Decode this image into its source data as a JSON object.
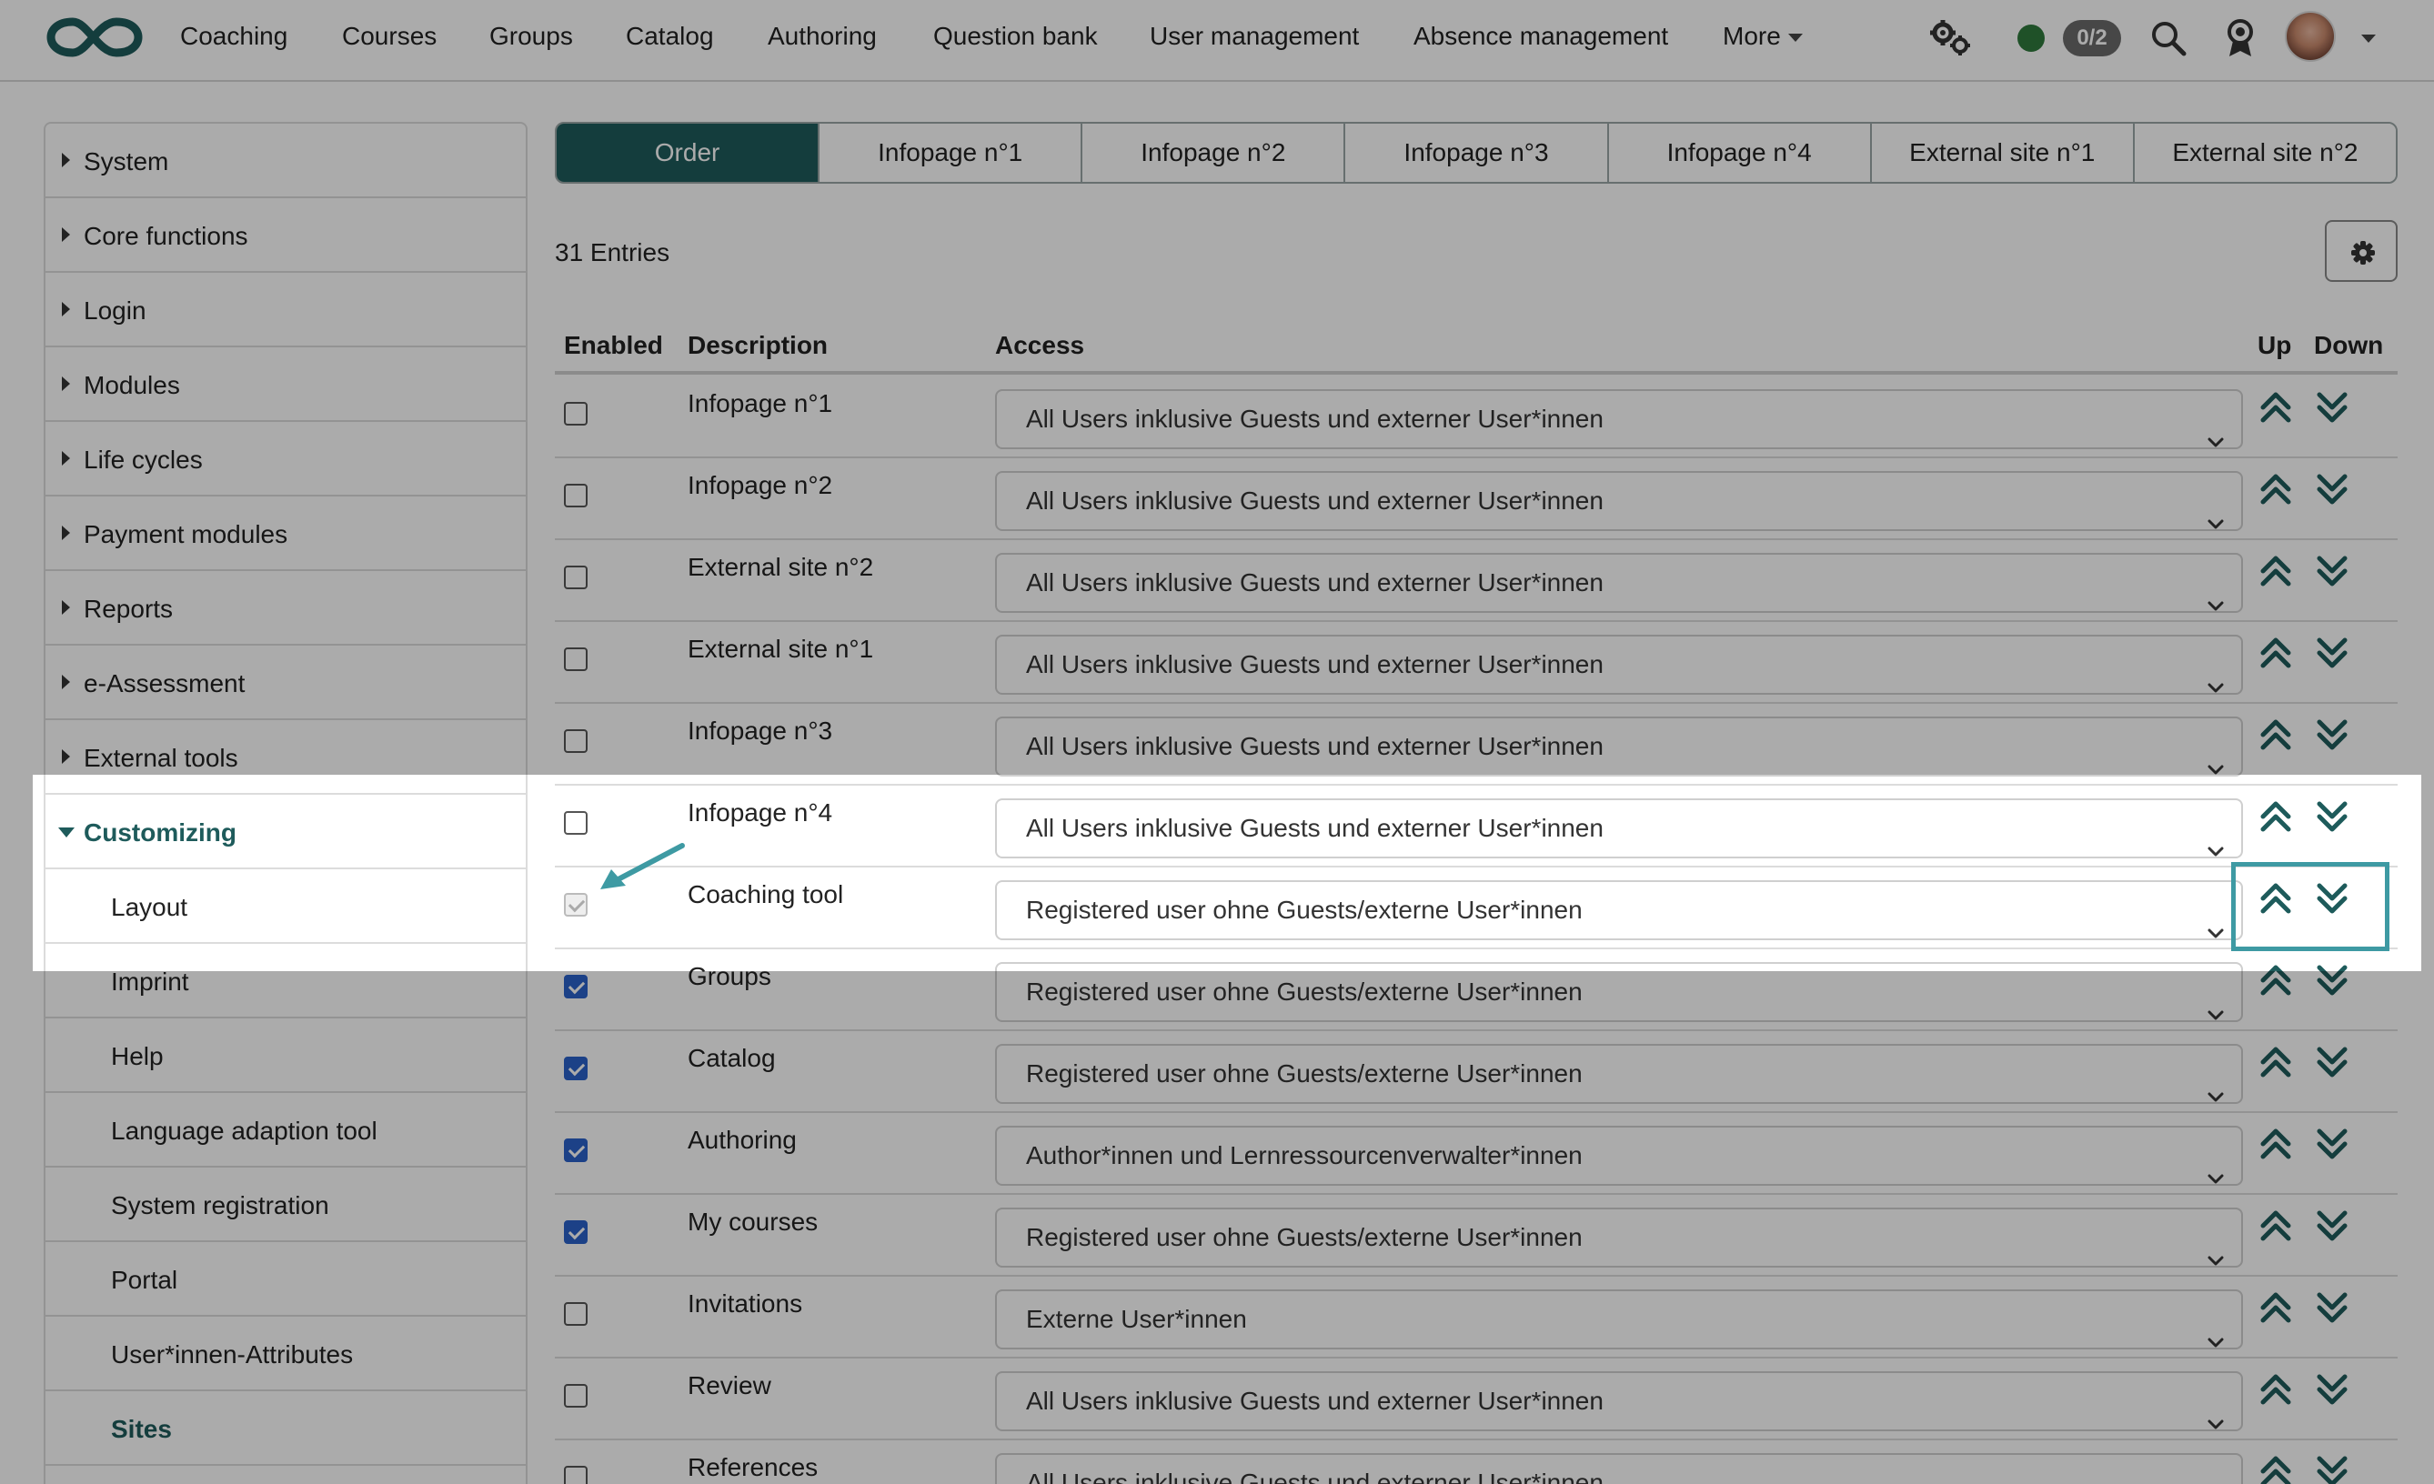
{
  "nav": {
    "items": [
      "Coaching",
      "Courses",
      "Groups",
      "Catalog",
      "Authoring",
      "Question bank",
      "User management",
      "Absence management",
      "More"
    ],
    "counter": "0/2",
    "status_color": "#2f7a3d"
  },
  "sidebar": {
    "items": [
      {
        "label": "System",
        "kind": "collapsed"
      },
      {
        "label": "Core functions",
        "kind": "collapsed"
      },
      {
        "label": "Login",
        "kind": "collapsed"
      },
      {
        "label": "Modules",
        "kind": "collapsed"
      },
      {
        "label": "Life cycles",
        "kind": "collapsed"
      },
      {
        "label": "Payment modules",
        "kind": "collapsed"
      },
      {
        "label": "Reports",
        "kind": "collapsed"
      },
      {
        "label": "e-Assessment",
        "kind": "collapsed"
      },
      {
        "label": "External tools",
        "kind": "collapsed"
      },
      {
        "label": "Customizing",
        "kind": "expanded"
      },
      {
        "label": "Layout",
        "kind": "sub"
      },
      {
        "label": "Imprint",
        "kind": "sub"
      },
      {
        "label": "Help",
        "kind": "sub"
      },
      {
        "label": "Language adaption tool",
        "kind": "sub"
      },
      {
        "label": "System registration",
        "kind": "sub"
      },
      {
        "label": "Portal",
        "kind": "sub"
      },
      {
        "label": "User*innen-Attributes",
        "kind": "sub"
      },
      {
        "label": "Sites",
        "kind": "sub-active"
      }
    ]
  },
  "tabs": [
    "Order",
    "Infopage n°1",
    "Infopage n°2",
    "Infopage n°3",
    "Infopage n°4",
    "External site n°1",
    "External site n°2"
  ],
  "table": {
    "entries": "31 Entries",
    "headers": {
      "enabled": "Enabled",
      "description": "Description",
      "access": "Access",
      "up": "Up",
      "down": "Down"
    },
    "rows": [
      {
        "enabled": "unchecked",
        "description": "Infopage n°1",
        "access": "All Users inklusive Guests und externer User*innen"
      },
      {
        "enabled": "unchecked",
        "description": "Infopage n°2",
        "access": "All Users inklusive Guests und externer User*innen"
      },
      {
        "enabled": "unchecked",
        "description": "External site n°2",
        "access": "All Users inklusive Guests und externer User*innen"
      },
      {
        "enabled": "unchecked",
        "description": "External site n°1",
        "access": "All Users inklusive Guests und externer User*innen"
      },
      {
        "enabled": "unchecked",
        "description": "Infopage n°3",
        "access": "All Users inklusive Guests und externer User*innen"
      },
      {
        "enabled": "unchecked",
        "description": "Infopage n°4",
        "access": "All Users inklusive Guests und externer User*innen"
      },
      {
        "enabled": "disabled-checked",
        "description": "Coaching tool",
        "access": "Registered user ohne Guests/externe User*innen"
      },
      {
        "enabled": "checked",
        "description": "Groups",
        "access": "Registered user ohne Guests/externe User*innen"
      },
      {
        "enabled": "checked",
        "description": "Catalog",
        "access": "Registered user ohne Guests/externe User*innen"
      },
      {
        "enabled": "checked",
        "description": "Authoring",
        "access": "Author*innen und Lernressourcenverwalter*innen"
      },
      {
        "enabled": "checked",
        "description": "My courses",
        "access": "Registered user ohne Guests/externe User*innen"
      },
      {
        "enabled": "unchecked",
        "description": "Invitations",
        "access": "Externe User*innen"
      },
      {
        "enabled": "unchecked",
        "description": "Review",
        "access": "All Users inklusive Guests und externer User*innen"
      },
      {
        "enabled": "unchecked",
        "description": "References",
        "access": "All Users inklusive Guests und externer User*innen"
      }
    ]
  },
  "colors": {
    "brand": "#1e5b5b",
    "accent": "#3e9aa3",
    "checkbox": "#2a62c9"
  }
}
